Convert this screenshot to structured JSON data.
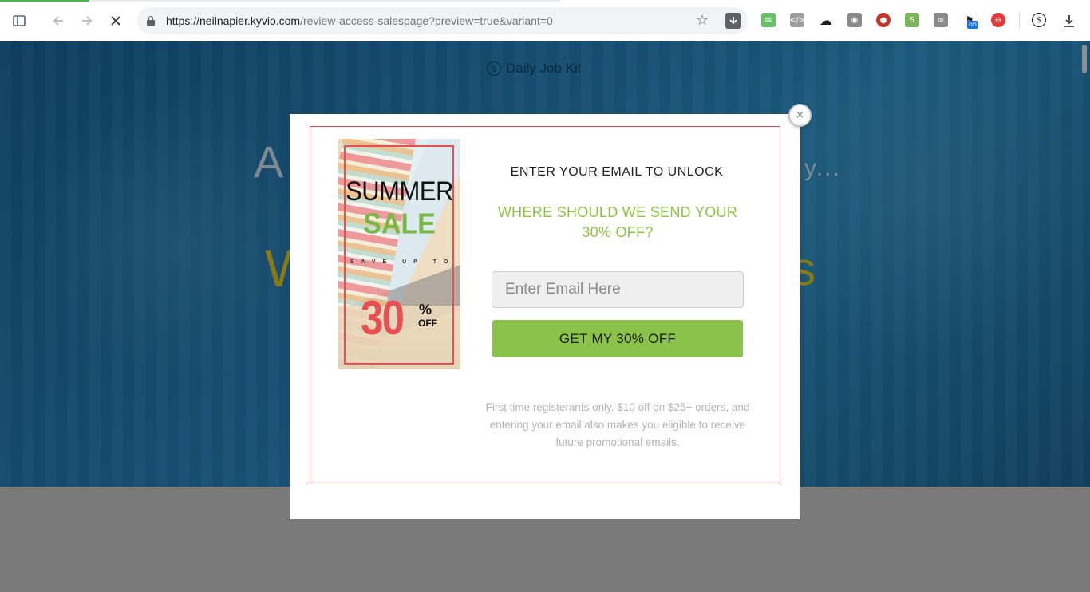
{
  "browser": {
    "url_host": "https://neilnapier.kyvio.com",
    "url_path": "/review-access-salespage?preview=true&variant=0",
    "extensions": [
      {
        "name": "mail-extension-icon",
        "color": "#6abf69"
      },
      {
        "name": "code-extension-icon",
        "color": "#9e9e9e"
      },
      {
        "name": "cloud-extension-icon",
        "color": "#202124"
      },
      {
        "name": "camera-extension-icon",
        "color": "#8a8a8a"
      },
      {
        "name": "lady-bug-extension-icon",
        "color": "#c0392b"
      },
      {
        "name": "shopify-extension-icon",
        "color": "#7ab55c"
      },
      {
        "name": "link-extension-icon",
        "color": "#8a8a8a"
      },
      {
        "name": "tag-extension-icon",
        "color": "#202124"
      },
      {
        "name": "block-extension-icon",
        "color": "#e53935"
      }
    ],
    "ext_badge": "on"
  },
  "hero": {
    "brand": "Daily Job Kit",
    "line1_left": "A",
    "line1_right": "y...",
    "line2_left": "W",
    "line2_right": "s"
  },
  "popup": {
    "sale": {
      "summer": "SUMMER",
      "sale": "SALE",
      "save_up_to": "SAVE UP TO",
      "percent": "30",
      "pct_sign": "%",
      "off": "OFF"
    },
    "unlock_text": "ENTER YOUR EMAIL TO UNLOCK",
    "headline": "WHERE SHOULD WE SEND YOUR 30% OFF?",
    "email_placeholder": "Enter Email Here",
    "cta_label": "GET MY 30% OFF",
    "fine_print": "First time registerants only. $10 off on $25+ orders, and entering your email also makes you eligible to receive future promotional emails.",
    "close_label": "×"
  },
  "colors": {
    "accent_green": "#8dc63f",
    "button_green": "#8bc34a",
    "frame_red": "#e5474f"
  }
}
